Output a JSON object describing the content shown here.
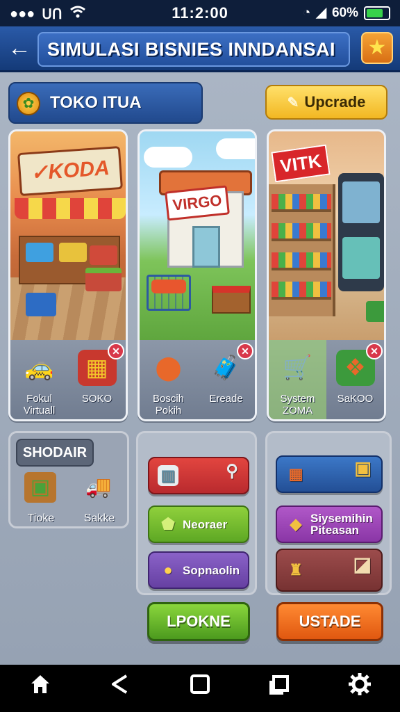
{
  "status_bar": {
    "time": "11:2:00",
    "left_icons": [
      "signal-dots-icon",
      "sim-icon",
      "wifi-icon"
    ],
    "right_icons": [
      "clock-icon",
      "signal-icon",
      "percent-icon"
    ],
    "battery_text": "60%",
    "battery_level": 0.76
  },
  "header": {
    "title": "SIMULASI BISNIES INNDANSAI",
    "back_icon": "arrow-left-icon",
    "star_icon": "star-icon"
  },
  "shop": {
    "name": "TOKO ITUA",
    "coin_icon": "coin-icon",
    "upgrade_label": "Upcrade"
  },
  "cards": [
    {
      "sign": "KODA",
      "tools": [
        {
          "icon": "car-icon",
          "label": "Fokul Virtuall"
        },
        {
          "icon": "register-icon",
          "label": "SOKO",
          "badge": "✕"
        }
      ]
    },
    {
      "sign": "VIRGO",
      "tools": [
        {
          "icon": "machine-icon",
          "label": "Boscih Pokih"
        },
        {
          "icon": "trolley-bag-icon",
          "label": "Ereade",
          "badge": "✕"
        }
      ]
    },
    {
      "sign": "VITK",
      "tools": [
        {
          "icon": "cart-icon",
          "label": "System ZOMA"
        },
        {
          "icon": "map-icon",
          "label": "SaKOO",
          "badge": "✕"
        }
      ]
    }
  ],
  "lower": {
    "panel1": {
      "tab": "SHODAIR",
      "items": [
        {
          "icon": "crate-icon",
          "label": "Tioke"
        },
        {
          "icon": "truck-icon",
          "label": "Sakke"
        }
      ]
    },
    "panel2": [
      {
        "icon": "building-icon",
        "label": "",
        "color": "red"
      },
      {
        "icon": "tag-icon",
        "label": "Neoraer",
        "color": "green"
      },
      {
        "icon": "coin-icon",
        "label": "Sopnaolin",
        "color": "purple"
      }
    ],
    "panel3": [
      {
        "icon": "box-icon",
        "label": "",
        "color": "blue"
      },
      {
        "icon": "gift-icon",
        "label": "Siysemihin Piteasan",
        "color": "magenta"
      },
      {
        "icon": "lantern-icon",
        "label": "",
        "color": "maroon"
      }
    ]
  },
  "actions": {
    "green_label": "LPOKNE",
    "orange_label": "USTADE"
  },
  "nav": [
    "home-icon",
    "back-icon",
    "recent-apps-icon",
    "switch-icon",
    "settings-icon"
  ]
}
